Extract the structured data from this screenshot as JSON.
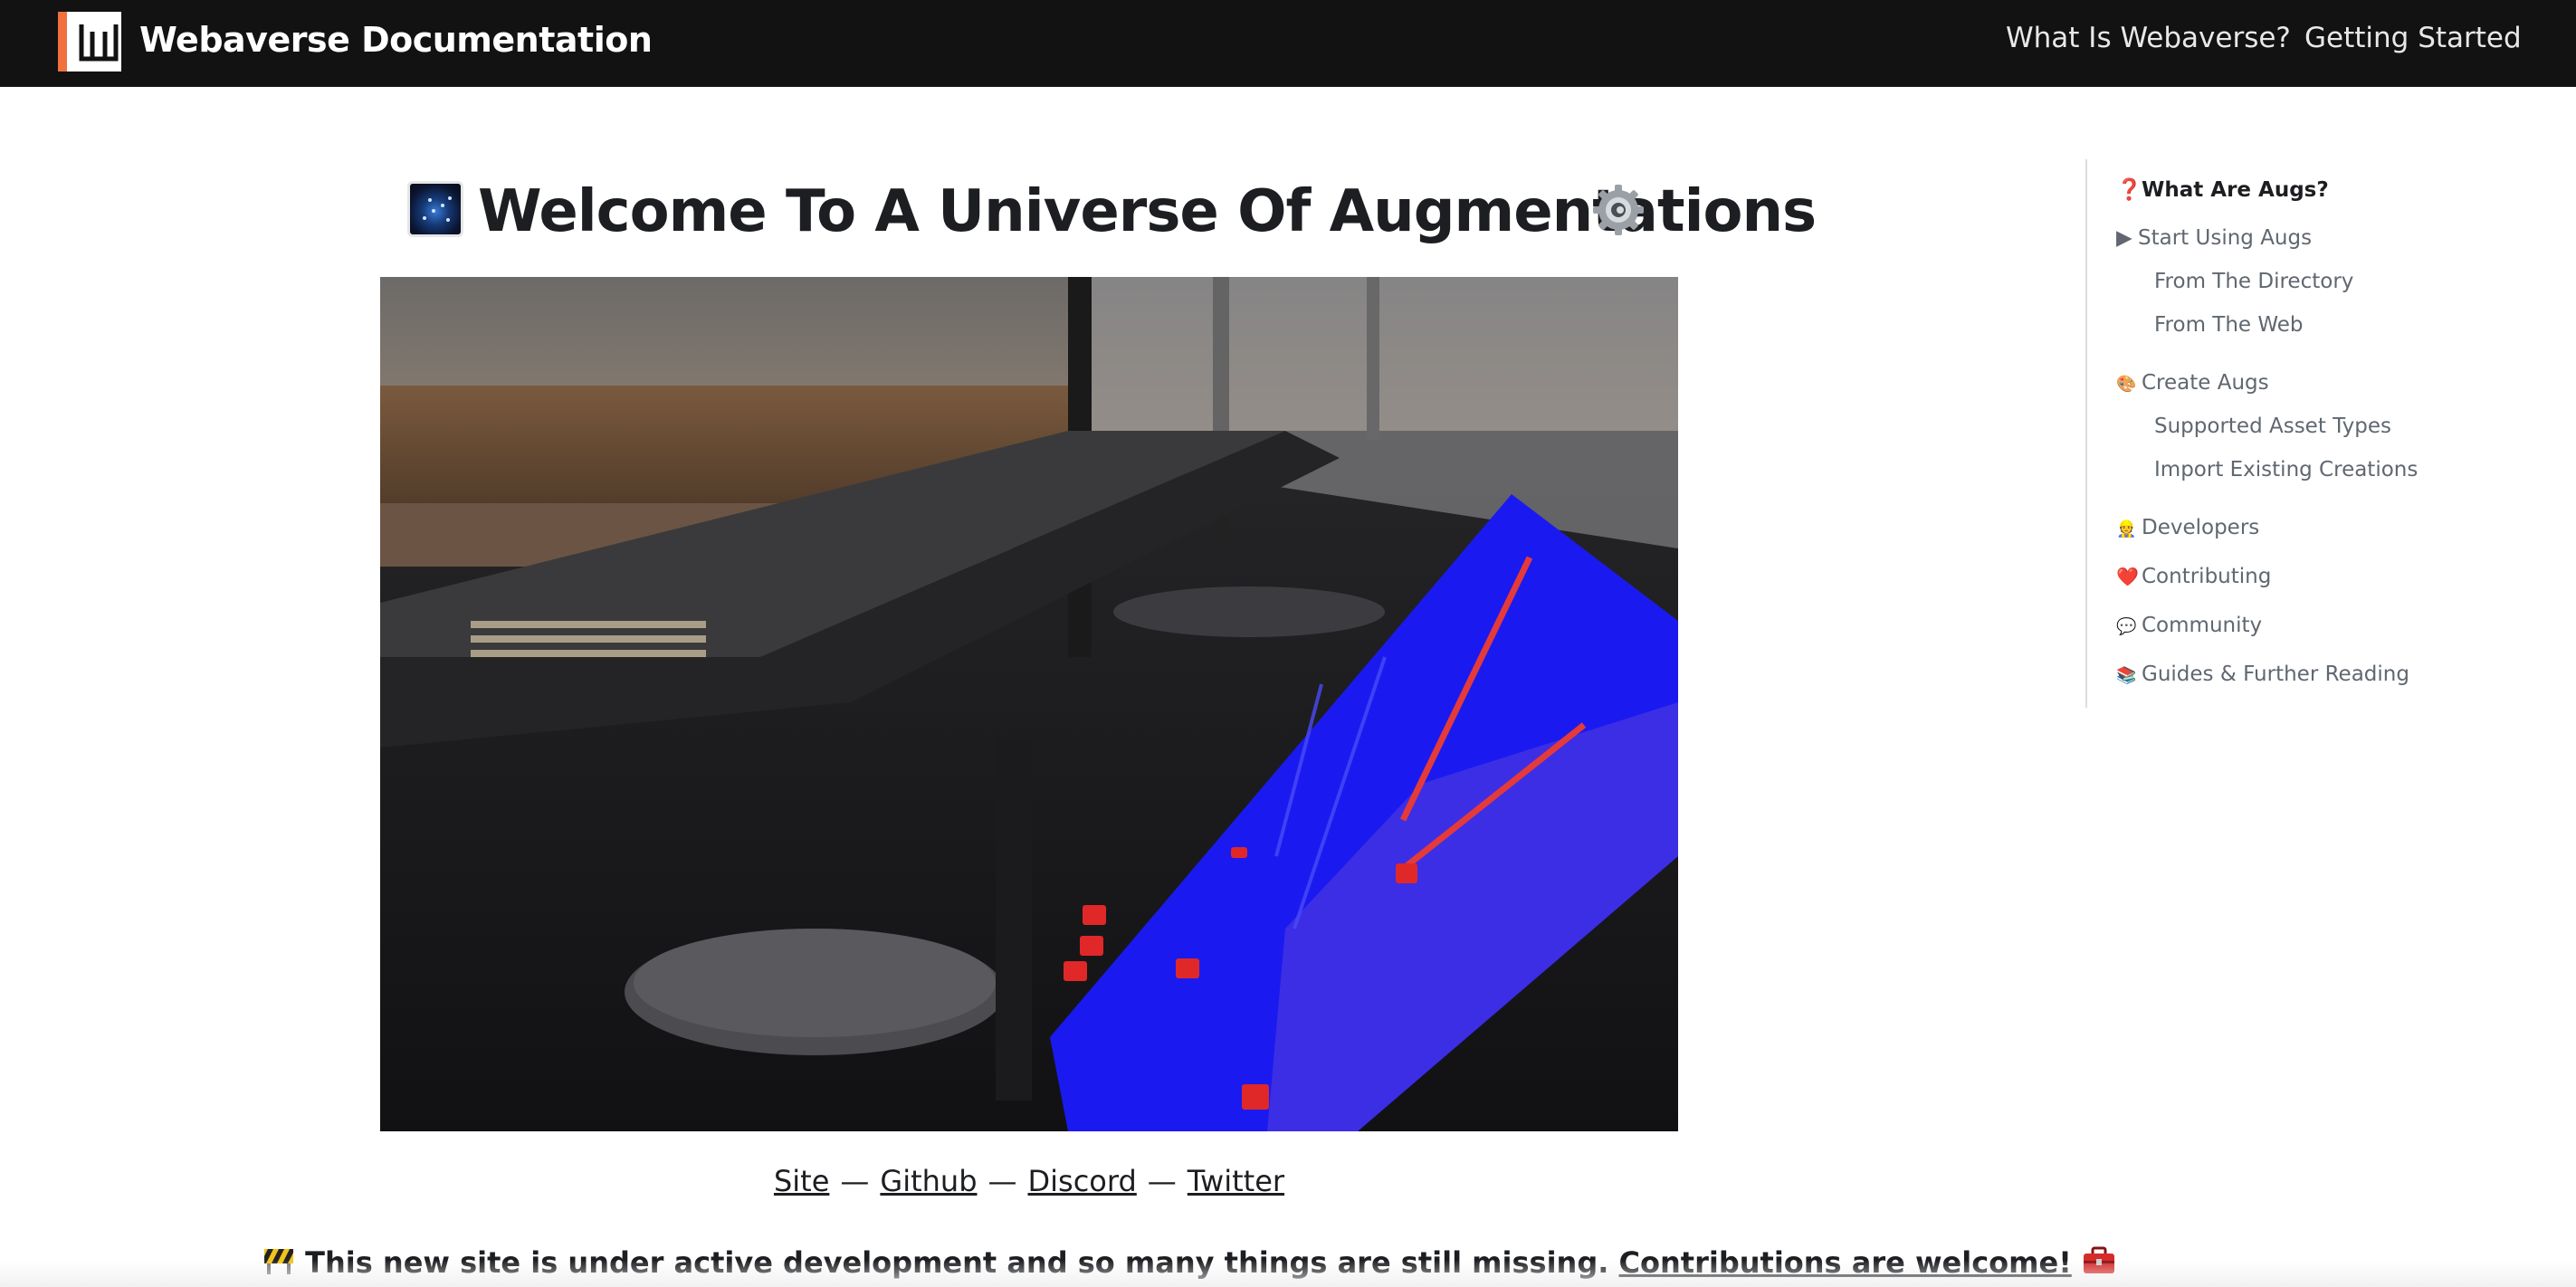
{
  "navbar": {
    "brand": "Webaverse Documentation",
    "links": [
      "What Is Webaverse?",
      "Getting Started"
    ]
  },
  "page": {
    "title": "Welcome To A Universe Of Augmentations",
    "title_icons": [
      "galaxy-icon",
      "gear-icon"
    ],
    "hero_image": "augmented reality camera view with blue depth overlay",
    "links": [
      "Site",
      "Github",
      "Discord",
      "Twitter"
    ],
    "link_separator": "—",
    "notice_text": "This new site is under active development and so many things are still missing.",
    "notice_link": "Contributions are welcome!",
    "notice_icons": [
      "construction-icon",
      "toolbox-icon"
    ]
  },
  "toc": {
    "items": [
      {
        "icon": "❓",
        "label": "What Are Augs?",
        "level": 1,
        "active": true
      },
      {
        "icon": "▶",
        "label": "Start Using Augs",
        "level": 1
      },
      {
        "icon": "",
        "label": "From The Directory",
        "level": 2
      },
      {
        "icon": "",
        "label": "From The Web",
        "level": 2
      },
      {
        "icon": "🎨",
        "label": "Create Augs",
        "level": 1
      },
      {
        "icon": "",
        "label": "Supported Asset Types",
        "level": 2
      },
      {
        "icon": "",
        "label": "Import Existing Creations",
        "level": 2
      },
      {
        "icon": "👷",
        "label": "Developers",
        "level": 1
      },
      {
        "icon": "❤️",
        "label": "Contributing",
        "level": 1
      },
      {
        "icon": "💬",
        "label": "Community",
        "level": 1
      },
      {
        "icon": "📚",
        "label": "Guides & Further Reading",
        "level": 1
      }
    ]
  },
  "colors": {
    "navbar_bg": "#121212",
    "logo_accent": "#f0713e",
    "text": "#1c1e21",
    "toc_text": "#606770"
  }
}
